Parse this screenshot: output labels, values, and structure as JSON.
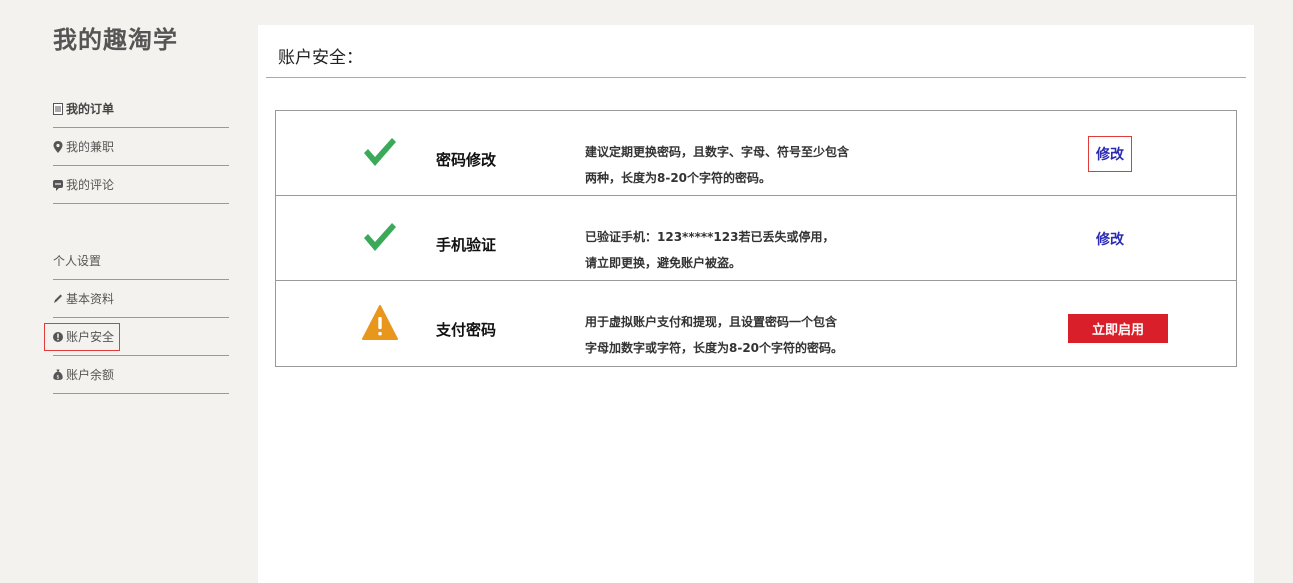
{
  "sidebar": {
    "brand": "我的趣淘学",
    "items": [
      {
        "label": "我的订单",
        "icon": "document-icon"
      },
      {
        "label": "我的兼职",
        "icon": "map-pin-icon"
      },
      {
        "label": "我的评论",
        "icon": "speech-bubble-icon"
      }
    ],
    "section_title": "个人设置",
    "settings": [
      {
        "label": "基本资料",
        "icon": "pencil-icon"
      },
      {
        "label": "账户安全",
        "icon": "exclamation-icon",
        "active": true
      },
      {
        "label": "账户余额",
        "icon": "money-bag-icon"
      }
    ]
  },
  "panel": {
    "title": "账户安全：",
    "rows": [
      {
        "status_icon": "check-icon",
        "name": "密码修改",
        "desc_line1": "建议定期更换密码，且数字、字母、符号至少包含",
        "desc_line2": "两种，长度为8-20个字符的密码。",
        "action": "修改"
      },
      {
        "status_icon": "check-icon",
        "name": "手机验证",
        "desc_line1": "已验证手机：123*****123若已丢失或停用，",
        "desc_line2": "请立即更换，避免账户被盗。",
        "action": "修改"
      },
      {
        "status_icon": "warning-icon",
        "name": "支付密码",
        "desc_line1": "用于虚拟账户支付和提现，且设置密码一个包含",
        "desc_line2": "字母加数字或字符，长度为8-20个字符的密码。",
        "action": "立即启用"
      }
    ]
  },
  "colors": {
    "background": "#f3f2ee",
    "check": "#3aaa5a",
    "warning": "#e8961c",
    "accent_red": "#d91f2a",
    "link_blue": "#2b2bb5"
  }
}
